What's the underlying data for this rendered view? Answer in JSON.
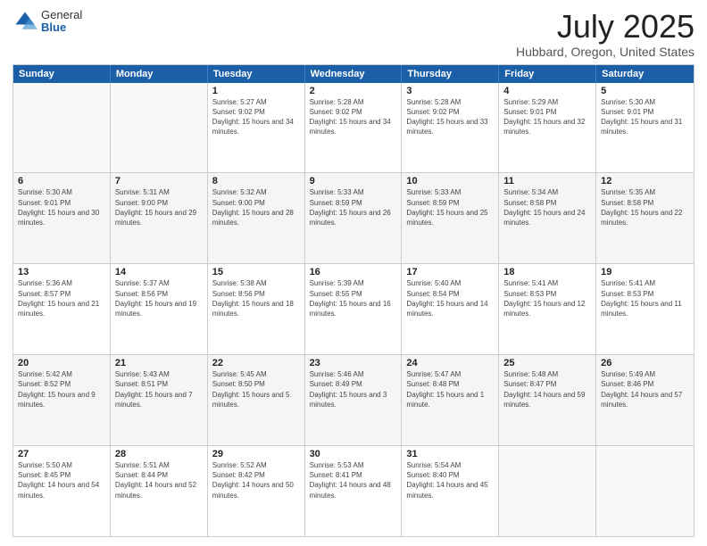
{
  "header": {
    "logo_general": "General",
    "logo_blue": "Blue",
    "title": "July 2025",
    "location": "Hubbard, Oregon, United States"
  },
  "weekdays": [
    "Sunday",
    "Monday",
    "Tuesday",
    "Wednesday",
    "Thursday",
    "Friday",
    "Saturday"
  ],
  "weeks": [
    [
      {
        "day": "",
        "sunrise": "",
        "sunset": "",
        "daylight": "",
        "empty": true
      },
      {
        "day": "",
        "sunrise": "",
        "sunset": "",
        "daylight": "",
        "empty": true
      },
      {
        "day": "1",
        "sunrise": "Sunrise: 5:27 AM",
        "sunset": "Sunset: 9:02 PM",
        "daylight": "Daylight: 15 hours and 34 minutes."
      },
      {
        "day": "2",
        "sunrise": "Sunrise: 5:28 AM",
        "sunset": "Sunset: 9:02 PM",
        "daylight": "Daylight: 15 hours and 34 minutes."
      },
      {
        "day": "3",
        "sunrise": "Sunrise: 5:28 AM",
        "sunset": "Sunset: 9:02 PM",
        "daylight": "Daylight: 15 hours and 33 minutes."
      },
      {
        "day": "4",
        "sunrise": "Sunrise: 5:29 AM",
        "sunset": "Sunset: 9:01 PM",
        "daylight": "Daylight: 15 hours and 32 minutes."
      },
      {
        "day": "5",
        "sunrise": "Sunrise: 5:30 AM",
        "sunset": "Sunset: 9:01 PM",
        "daylight": "Daylight: 15 hours and 31 minutes."
      }
    ],
    [
      {
        "day": "6",
        "sunrise": "Sunrise: 5:30 AM",
        "sunset": "Sunset: 9:01 PM",
        "daylight": "Daylight: 15 hours and 30 minutes."
      },
      {
        "day": "7",
        "sunrise": "Sunrise: 5:31 AM",
        "sunset": "Sunset: 9:00 PM",
        "daylight": "Daylight: 15 hours and 29 minutes."
      },
      {
        "day": "8",
        "sunrise": "Sunrise: 5:32 AM",
        "sunset": "Sunset: 9:00 PM",
        "daylight": "Daylight: 15 hours and 28 minutes."
      },
      {
        "day": "9",
        "sunrise": "Sunrise: 5:33 AM",
        "sunset": "Sunset: 8:59 PM",
        "daylight": "Daylight: 15 hours and 26 minutes."
      },
      {
        "day": "10",
        "sunrise": "Sunrise: 5:33 AM",
        "sunset": "Sunset: 8:59 PM",
        "daylight": "Daylight: 15 hours and 25 minutes."
      },
      {
        "day": "11",
        "sunrise": "Sunrise: 5:34 AM",
        "sunset": "Sunset: 8:58 PM",
        "daylight": "Daylight: 15 hours and 24 minutes."
      },
      {
        "day": "12",
        "sunrise": "Sunrise: 5:35 AM",
        "sunset": "Sunset: 8:58 PM",
        "daylight": "Daylight: 15 hours and 22 minutes."
      }
    ],
    [
      {
        "day": "13",
        "sunrise": "Sunrise: 5:36 AM",
        "sunset": "Sunset: 8:57 PM",
        "daylight": "Daylight: 15 hours and 21 minutes."
      },
      {
        "day": "14",
        "sunrise": "Sunrise: 5:37 AM",
        "sunset": "Sunset: 8:56 PM",
        "daylight": "Daylight: 15 hours and 19 minutes."
      },
      {
        "day": "15",
        "sunrise": "Sunrise: 5:38 AM",
        "sunset": "Sunset: 8:56 PM",
        "daylight": "Daylight: 15 hours and 18 minutes."
      },
      {
        "day": "16",
        "sunrise": "Sunrise: 5:39 AM",
        "sunset": "Sunset: 8:55 PM",
        "daylight": "Daylight: 15 hours and 16 minutes."
      },
      {
        "day": "17",
        "sunrise": "Sunrise: 5:40 AM",
        "sunset": "Sunset: 8:54 PM",
        "daylight": "Daylight: 15 hours and 14 minutes."
      },
      {
        "day": "18",
        "sunrise": "Sunrise: 5:41 AM",
        "sunset": "Sunset: 8:53 PM",
        "daylight": "Daylight: 15 hours and 12 minutes."
      },
      {
        "day": "19",
        "sunrise": "Sunrise: 5:41 AM",
        "sunset": "Sunset: 8:53 PM",
        "daylight": "Daylight: 15 hours and 11 minutes."
      }
    ],
    [
      {
        "day": "20",
        "sunrise": "Sunrise: 5:42 AM",
        "sunset": "Sunset: 8:52 PM",
        "daylight": "Daylight: 15 hours and 9 minutes."
      },
      {
        "day": "21",
        "sunrise": "Sunrise: 5:43 AM",
        "sunset": "Sunset: 8:51 PM",
        "daylight": "Daylight: 15 hours and 7 minutes."
      },
      {
        "day": "22",
        "sunrise": "Sunrise: 5:45 AM",
        "sunset": "Sunset: 8:50 PM",
        "daylight": "Daylight: 15 hours and 5 minutes."
      },
      {
        "day": "23",
        "sunrise": "Sunrise: 5:46 AM",
        "sunset": "Sunset: 8:49 PM",
        "daylight": "Daylight: 15 hours and 3 minutes."
      },
      {
        "day": "24",
        "sunrise": "Sunrise: 5:47 AM",
        "sunset": "Sunset: 8:48 PM",
        "daylight": "Daylight: 15 hours and 1 minute."
      },
      {
        "day": "25",
        "sunrise": "Sunrise: 5:48 AM",
        "sunset": "Sunset: 8:47 PM",
        "daylight": "Daylight: 14 hours and 59 minutes."
      },
      {
        "day": "26",
        "sunrise": "Sunrise: 5:49 AM",
        "sunset": "Sunset: 8:46 PM",
        "daylight": "Daylight: 14 hours and 57 minutes."
      }
    ],
    [
      {
        "day": "27",
        "sunrise": "Sunrise: 5:50 AM",
        "sunset": "Sunset: 8:45 PM",
        "daylight": "Daylight: 14 hours and 54 minutes."
      },
      {
        "day": "28",
        "sunrise": "Sunrise: 5:51 AM",
        "sunset": "Sunset: 8:44 PM",
        "daylight": "Daylight: 14 hours and 52 minutes."
      },
      {
        "day": "29",
        "sunrise": "Sunrise: 5:52 AM",
        "sunset": "Sunset: 8:42 PM",
        "daylight": "Daylight: 14 hours and 50 minutes."
      },
      {
        "day": "30",
        "sunrise": "Sunrise: 5:53 AM",
        "sunset": "Sunset: 8:41 PM",
        "daylight": "Daylight: 14 hours and 48 minutes."
      },
      {
        "day": "31",
        "sunrise": "Sunrise: 5:54 AM",
        "sunset": "Sunset: 8:40 PM",
        "daylight": "Daylight: 14 hours and 45 minutes."
      },
      {
        "day": "",
        "sunrise": "",
        "sunset": "",
        "daylight": "",
        "empty": true
      },
      {
        "day": "",
        "sunrise": "",
        "sunset": "",
        "daylight": "",
        "empty": true
      }
    ]
  ]
}
